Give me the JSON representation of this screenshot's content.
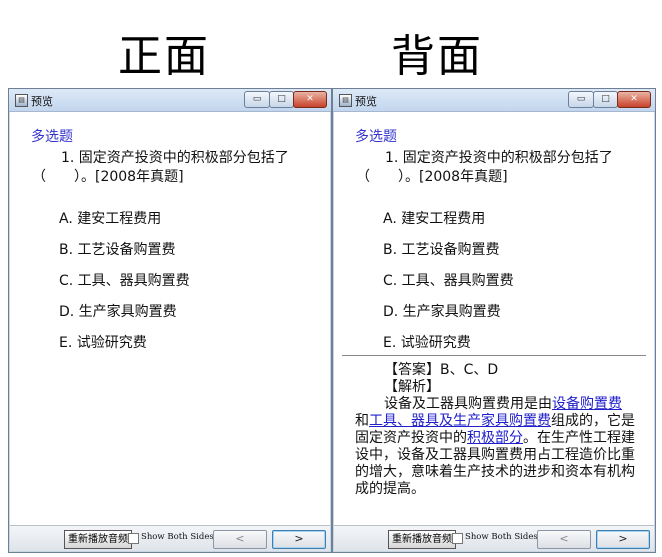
{
  "headings": {
    "front": "正面",
    "back": "背面"
  },
  "window": {
    "title": "预览",
    "app_icon_glyph": "▤",
    "controls": {
      "minimize": "▭",
      "maximize": "□",
      "close": "✕"
    }
  },
  "question": {
    "type": "多选题",
    "stem": "1. 固定资产投资中的积极部分包括了（　　）。[2008年真题]",
    "options": [
      "A. 建安工程费用",
      "B. 工艺设备购置费",
      "C. 工具、器具购置费",
      "D. 生产家具购置费",
      "E. 试验研究费"
    ]
  },
  "answer": {
    "answer_line": "【答案】B、C、D",
    "analysis_heading": "【解析】",
    "p1": "设备及工器具购置费用是由",
    "link1": "设备购置费",
    "p2": "和",
    "link2": "工具、器具及生产家具购置费",
    "p3": "组成的，它是固定资产投资中的",
    "link3": "积极部分",
    "p4": "。在生产性工程建设中，设备及工器具购置费用占工程造价比重的增大，意味着生产技术的进步和资本有机构成的提高。"
  },
  "bottom": {
    "replay_label": "重新播放音频",
    "show_both_label": "Show Both Sides",
    "prev_label": "<",
    "next_label": ">"
  }
}
